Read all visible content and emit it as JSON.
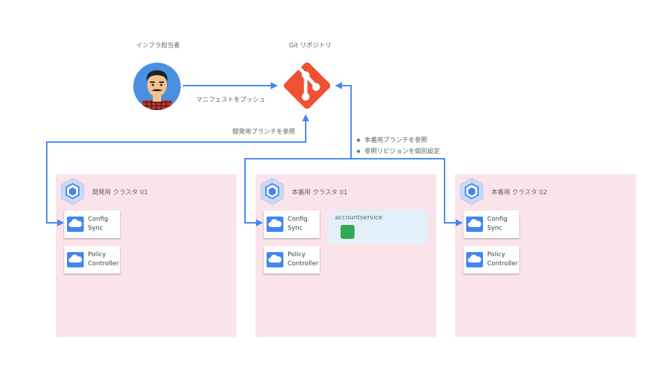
{
  "actors": {
    "infra_admin_label": "インフラ担当者",
    "git_label": "Git リポジトリ"
  },
  "edges": {
    "push_label": "マニフェストをプッシュ",
    "dev_ref_label": "開発用ブランチを参照",
    "prod_notes": [
      "本番用ブランチを参照",
      "参照リビジョンを個別設定"
    ]
  },
  "clusters": [
    {
      "title": "開発用 クラスタ 01",
      "components": [
        {
          "line1": "Config",
          "line2": "Sync"
        },
        {
          "line1": "Policy",
          "line2": "Controller"
        }
      ]
    },
    {
      "title": "本番用 クラスタ 01",
      "components": [
        {
          "line1": "Config",
          "line2": "Sync"
        },
        {
          "line1": "Policy",
          "line2": "Controller"
        }
      ],
      "namespace": {
        "label": "accountservice"
      }
    },
    {
      "title": "本番用 クラスタ 02",
      "components": [
        {
          "line1": "Config",
          "line2": "Sync"
        },
        {
          "line1": "Policy",
          "line2": "Controller"
        }
      ]
    }
  ],
  "colors": {
    "arrow": "#4285f4",
    "git": "#f05033",
    "cluster_bg": "#fbe3ea",
    "namespace_bg": "#e3f0fb",
    "pod": "#34a853"
  }
}
